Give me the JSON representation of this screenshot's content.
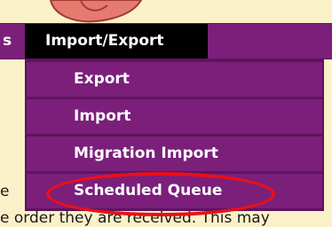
{
  "nav": {
    "prev_item_fragment": "s",
    "active_menu": "Import/Export"
  },
  "dropdown": {
    "items": [
      {
        "label": "Export"
      },
      {
        "label": "Import"
      },
      {
        "label": "Migration Import"
      },
      {
        "label": "Scheduled Queue"
      }
    ]
  },
  "background_text": {
    "left_fragment": "e",
    "bottom_fragment": "e order they are received. This may"
  },
  "colors": {
    "menu_purple": "#7b1f7b",
    "active_black": "#000000",
    "highlight_red": "#e8101a",
    "page_cream": "#fbf1c8"
  }
}
